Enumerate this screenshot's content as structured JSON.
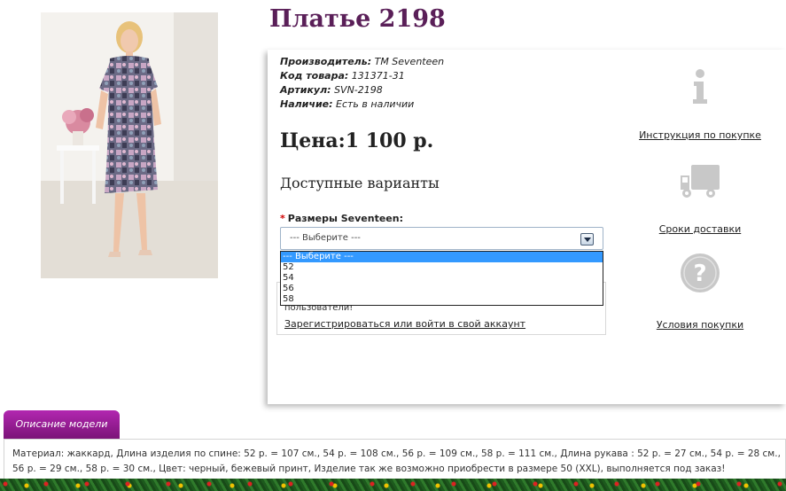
{
  "product": {
    "title": "Платье 2198",
    "photo_icon": "product-photo-dress"
  },
  "info": {
    "manufacturer_label": "Производитель:",
    "manufacturer_value": "ТМ Seventeen",
    "code_label": "Код товара:",
    "code_value": "131371-31",
    "article_label": "Артикул:",
    "article_value": "SVN-2198",
    "availability_label": "Наличие:",
    "availability_value": "Есть в наличии"
  },
  "price": "Цена:1 100 р.",
  "variants_heading": "Доступные варианты",
  "size": {
    "required_mark": "*",
    "label": "Размеры Seventeen:",
    "selected": "--- Выберите ---",
    "options": [
      "--- Выберите ---",
      "52",
      "54",
      "56",
      "58"
    ]
  },
  "notice": {
    "text": "пользователи!",
    "link": "Зарегистрироваться или войти в свой аккаунт"
  },
  "side": {
    "instructions": {
      "label": "Инструкция по покупке",
      "icon": "info-icon"
    },
    "delivery": {
      "label": "Сроки доставки",
      "icon": "truck-icon"
    },
    "terms": {
      "label": "Условия покупки",
      "icon": "question-icon"
    }
  },
  "description": {
    "tab_label": "Описание модели",
    "text": "Материал: жаккард, Длина изделия по спине: 52 р. = 107 см., 54 р. = 108 см., 56 р. = 109 см., 58 р. = 111 см., Длина рукава : 52 р. = 27 см., 54 р. = 28 см., 56 р. = 29 см., 58 р. = 30 см., Цвет: черный, бежевый принт, Изделие так же возможно приобрести в размере 50 (XXL), выполняется под заказ!"
  },
  "colors": {
    "title": "#5a1f58",
    "tab": "#9a1f98",
    "select_highlight": "#3399ff",
    "required": "#d00000"
  }
}
